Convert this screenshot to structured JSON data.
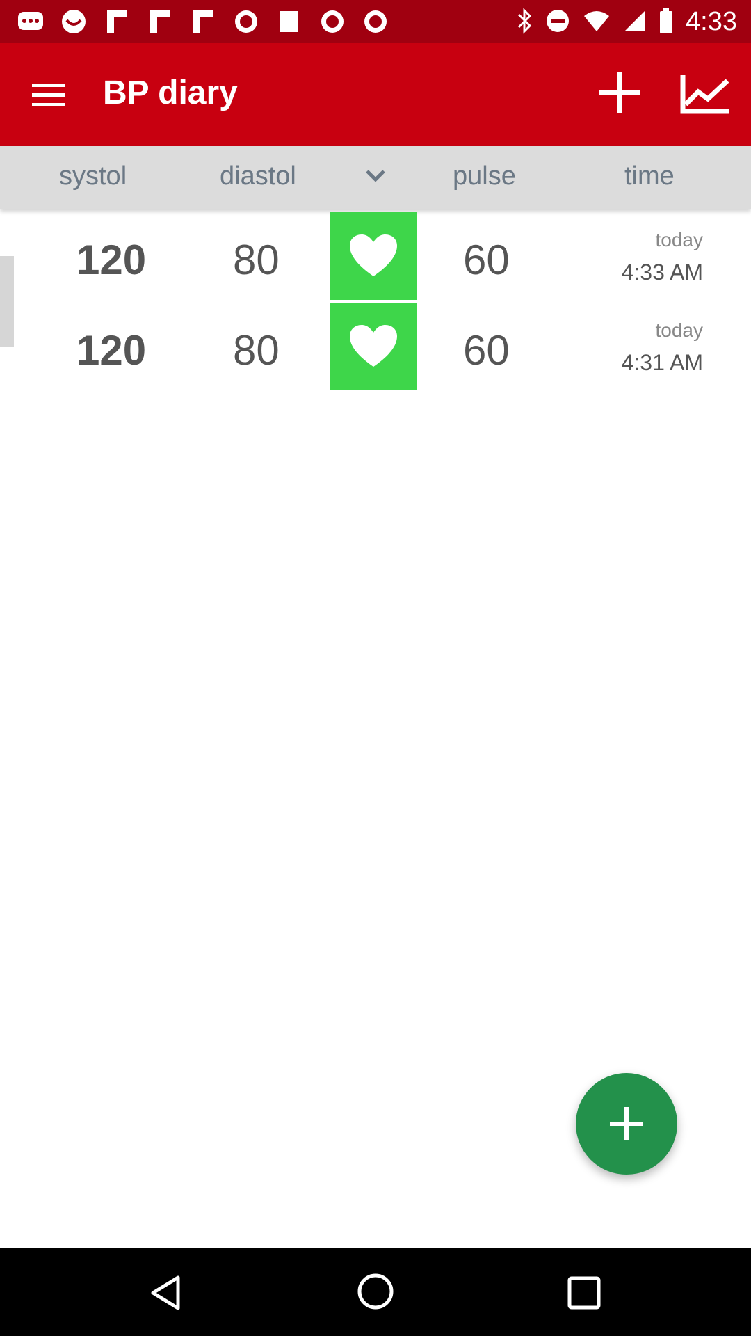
{
  "status_bar": {
    "time": "4:33",
    "icons": [
      "messaging-icon",
      "notification-icon",
      "flipboard-icon",
      "flipboard-icon",
      "flipboard-icon",
      "abc13-icon",
      "square-icon",
      "abc13-icon",
      "abc13-icon",
      "bluetooth-icon",
      "do-not-disturb-icon",
      "wifi-icon",
      "signal-icon",
      "battery-icon"
    ]
  },
  "app_bar": {
    "title": "BP diary",
    "menu_icon": "menu-icon",
    "add_icon": "plus-icon",
    "chart_icon": "chart-line-icon",
    "color": "#c80010"
  },
  "columns": {
    "systol": "systol",
    "diastol": "diastol",
    "pulse": "pulse",
    "time": "time"
  },
  "rows": [
    {
      "systol": "120",
      "diastol": "80",
      "pulse": "60",
      "day": "today",
      "time": "4:33 AM",
      "status_color": "#3ed64a",
      "status_icon": "heart-icon"
    },
    {
      "systol": "120",
      "diastol": "80",
      "pulse": "60",
      "day": "today",
      "time": "4:31 AM",
      "status_color": "#3ed64a",
      "status_icon": "heart-icon"
    }
  ],
  "fab": {
    "icon": "plus-icon",
    "color": "#23914b"
  }
}
